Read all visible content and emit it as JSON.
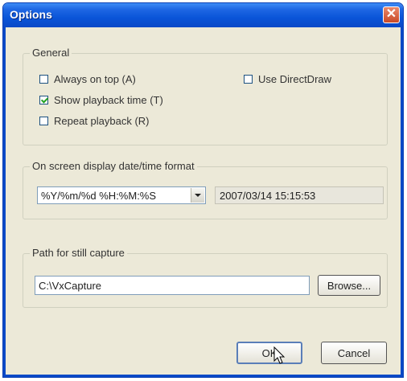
{
  "window": {
    "title": "Options"
  },
  "general": {
    "legend": "General",
    "always_on_top": {
      "label": "Always on top (A)",
      "checked": false
    },
    "use_directdraw": {
      "label": "Use DirectDraw",
      "checked": false
    },
    "show_playback_time": {
      "label": "Show playback time (T)",
      "checked": true
    },
    "repeat_playback": {
      "label": "Repeat playback (R)",
      "checked": false
    }
  },
  "osd": {
    "legend": "On screen display date/time format",
    "format_value": "%Y/%m/%d %H:%M:%S",
    "preview": "2007/03/14 15:15:53"
  },
  "capture": {
    "legend": "Path for still capture",
    "path": "C:\\VxCapture",
    "browse_label": "Browse..."
  },
  "buttons": {
    "ok": "OK",
    "cancel": "Cancel"
  },
  "colors": {
    "title_bar": "#0a55d8",
    "close_button": "#d4552f",
    "dialog_bg": "#ece9d8"
  }
}
